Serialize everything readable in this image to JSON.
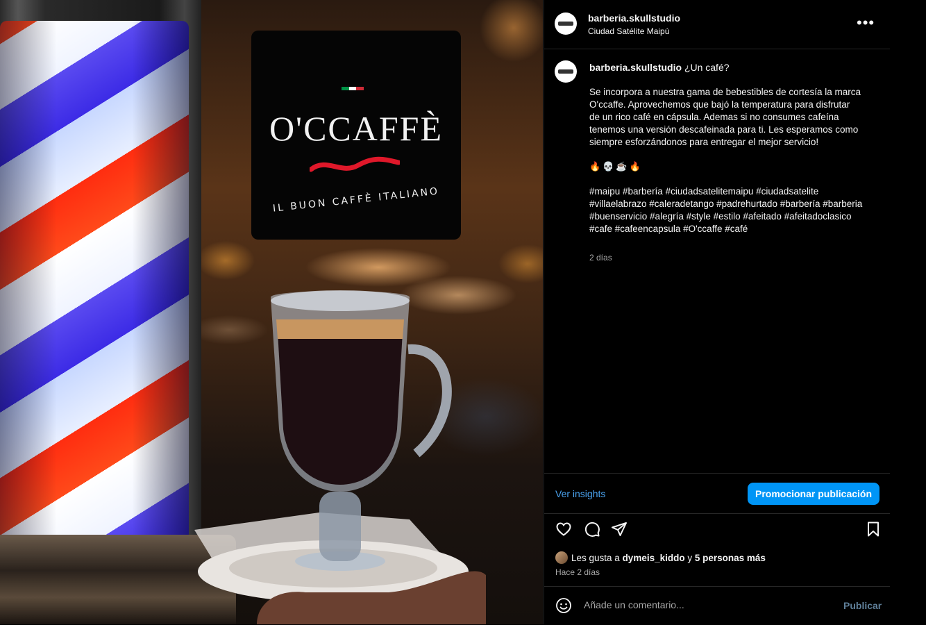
{
  "post_image": {
    "logo_name": "O'CCAFFÈ",
    "logo_tagline": "IL BUON CAFFÈ ITALIANO",
    "flag_colors": [
      "#009246",
      "#ffffff",
      "#ce2b37"
    ]
  },
  "header": {
    "username": "barberia.skullstudio",
    "location": "Ciudad Satélite Maipú",
    "more_label": "•••"
  },
  "caption": {
    "username": "barberia.skullstudio",
    "title": "¿Un café?",
    "body": "Se incorpora a nuestra gama de bebestibles de cortesía la marca\nO'ccaffe. Aprovechemos que bajó la temperatura para disfrutar\nde un rico café en cápsula. Ademas si no consumes cafeína\ntenemos una versión descafeinada para ti. Les esperamos como\nsiempre esforzándonos para entregar el mejor servicio!",
    "emojis": "🔥💀☕🔥",
    "hashtags": "#maipu #barbería #ciudadsatelitemaipu #ciudadsatelite #villaelabrazo #caleradetango #padrehurtado #barbería #barberia #buenservicio #alegría #style #estilo #afeitado #afeitadoclasico #cafe #cafeencapsula #O'ccaffe #café",
    "time": "2 días"
  },
  "insights": {
    "link_label": "Ver insights",
    "promote_label": "Promocionar publicación"
  },
  "likes": {
    "prefix": "Les gusta a ",
    "user": "dymeis_kiddo",
    "suffix": " y ",
    "others": "5 personas más"
  },
  "posted_label": "Hace 2 días",
  "comment": {
    "placeholder": "Añade un comentario...",
    "publish_label": "Publicar"
  },
  "colors": {
    "accent": "#0095f6",
    "link": "#4aa3f0",
    "muted": "#a8a8a8"
  }
}
